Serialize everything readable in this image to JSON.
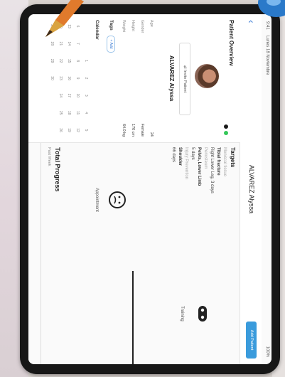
{
  "status": {
    "time": "9:41",
    "carrier": "Lunes 18 Noviembre",
    "battery": "100%"
  },
  "nav": {
    "back_icon": "chevron-left-icon",
    "title": "ALVAREZ Alyssa",
    "action_label": "Add Patient"
  },
  "sidebar": {
    "title": "Patient Overview",
    "invite_label": "Invite Patient",
    "patient_name": "ALVAREZ Alyssa",
    "fields": [
      {
        "label": "Age",
        "value": "24"
      },
      {
        "label": "Gender",
        "value": "Female"
      },
      {
        "label": "Height",
        "value": "170 cm"
      },
      {
        "label": "Weight",
        "value": "64.0 kg"
      }
    ],
    "tags_label": "Tags",
    "tags_button": "+ Add",
    "calendar_label": "Calendar",
    "calendar_rows": [
      [
        "",
        "",
        "1",
        "2",
        "3",
        "4",
        "5"
      ],
      [
        "6",
        "7",
        "8",
        "9",
        "10",
        "11",
        "12"
      ],
      [
        "13",
        "14",
        "15",
        "16",
        "17",
        "18",
        "19"
      ],
      [
        "20",
        "21",
        "22",
        "23",
        "24",
        "25",
        "26"
      ],
      [
        "27",
        "28",
        "29",
        "30",
        "",
        "",
        ""
      ]
    ]
  },
  "targets": {
    "heading": "Targets",
    "items": [
      {
        "text": "Meniscal tissue",
        "style": "muted"
      },
      {
        "text": "Tibial fracture",
        "style": "bold"
      },
      {
        "text": "Right Lower Leg, 3 days",
        "style": "normal"
      },
      {
        "text": "Periosteum",
        "style": "muted"
      },
      {
        "text": "Pelvis, Lower Limb",
        "style": "bold"
      },
      {
        "text": "5 days",
        "style": "normal"
      },
      {
        "text": "Injury Prevention",
        "style": "muted"
      },
      {
        "text": "Shoulder",
        "style": "bold"
      },
      {
        "text": "66 days",
        "style": "normal"
      }
    ]
  },
  "tiles": {
    "appointment": "Appointment",
    "training": "Training"
  },
  "progress": {
    "title": "Total Progress",
    "subtitle": "Past Week"
  },
  "colors": {
    "accent": "#3a9bdc",
    "online_dot": "#34c759",
    "secondary_dot": "#3a7bd5"
  }
}
